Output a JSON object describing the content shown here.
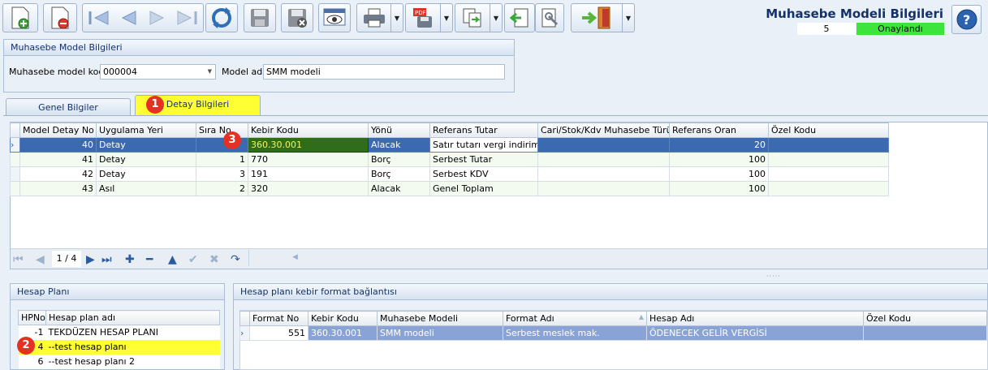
{
  "header": {
    "title": "Muhasebe Modeli Bilgileri",
    "record_no": "5",
    "status": "Onaylandı",
    "status_color": "#3ee33e"
  },
  "model_panel": {
    "title": "Muhasebe Model Bilgileri",
    "code_label": "Muhasebe model kodu",
    "code_value": "000004",
    "name_label": "Model adı",
    "name_value": "SMM modeli"
  },
  "tabs": [
    {
      "label": "Genel Bilgiler",
      "active": false
    },
    {
      "label": "Detay Bilgileri",
      "active": true
    }
  ],
  "markers": [
    "1",
    "2",
    "3"
  ],
  "detail_grid": {
    "columns": [
      "Model Detay No",
      "Uygulama Yeri",
      "Sıra No",
      "Kebir Kodu",
      "Yönü",
      "Referans Tutar",
      "Cari/Stok/Kdv Muhasebe Türü",
      "Referans Oran",
      "Özel Kodu"
    ],
    "rows": [
      [
        "40",
        "Detay",
        "",
        "360.30.001",
        "Alacak",
        "Satır tutarı vergi indirimi",
        "",
        "20",
        ""
      ],
      [
        "41",
        "Detay",
        "1",
        "770",
        "Borç",
        "Serbest Tutar",
        "",
        "100",
        ""
      ],
      [
        "42",
        "Detay",
        "3",
        "191",
        "Borç",
        "Serbest KDV",
        "",
        "100",
        ""
      ],
      [
        "43",
        "Asıl",
        "2",
        "320",
        "Alacak",
        "Genel Toplam",
        "",
        "100",
        ""
      ]
    ],
    "pager": "1 / 4"
  },
  "hesap_plani": {
    "title": "Hesap Planı",
    "columns": [
      "HPNo",
      "Hesap plan adı"
    ],
    "rows": [
      [
        "-1",
        "TEKDÜZEN HESAP PLANI"
      ],
      [
        "4",
        "--test hesap planı"
      ],
      [
        "6",
        "--test hesap planı 2"
      ]
    ]
  },
  "format_grid": {
    "title": "Hesap planı kebir format bağlantısı",
    "columns": [
      "Format No",
      "Kebir Kodu",
      "Muhasebe Modeli",
      "Format Adı",
      "Hesap Adı",
      "Özel Kodu"
    ],
    "rows": [
      [
        "551",
        "360.30.001",
        "SMM modeli",
        "Serbest meslek mak.",
        "ÖDENECEK GELİR VERGİSİ",
        ""
      ]
    ]
  }
}
